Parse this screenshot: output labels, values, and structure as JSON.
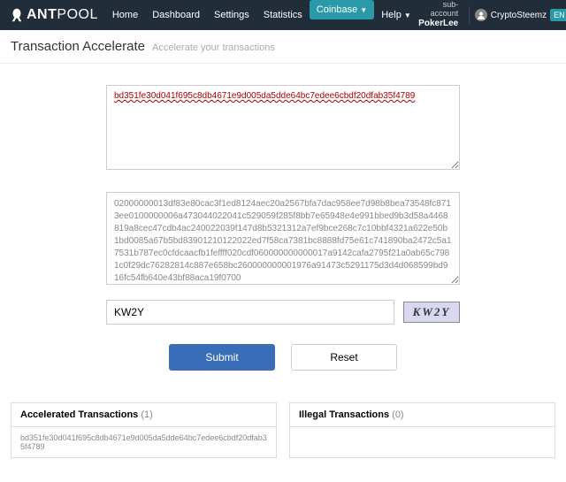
{
  "logo": {
    "brand_a": "ANT",
    "brand_b": "POOL"
  },
  "nav": {
    "home": "Home",
    "dashboard": "Dashboard",
    "settings": "Settings",
    "statistics": "Statistics",
    "coinbase": "Coinbase",
    "help": "Help"
  },
  "account": {
    "sub_label": "current sub-account",
    "sub_value": "PokerLee",
    "username": "CryptoSteemz",
    "lang": "EN"
  },
  "page": {
    "title": "Transaction Accelerate",
    "subtitle": "Accelerate your transactions"
  },
  "form": {
    "txid": "bd351fe30d041f695c8db4671e9d005da5dde64bc7edee6cbdf20dfab35f4789",
    "rawtx": "02000000013df83e80cac3f1ed8124aec20a2567bfa7dac958ee7d98b8bea73548fc8713ee0100000006a473044022041c529059f285f8bb7e65948e4e991bbed9b3d58a4468819a8cec47cdb4ac240022039f147d8b5321312a7ef9bce268c7c10bbf4321a622e50b1bd0085a67b5bd83901210122022ed7f58ca7381bc8888fd75e61c741890ba2472c5a17531b787ec0cfdcaacfb1feffff020cdf060000000000017a9142cafa2795f21a0ab65c7981c0f29dc76282814c887e658bc260000000001976a91473c5291175d3d4d068599bd916fc54fb640e43bf88aca19f0700",
    "captcha_value": "KW2Y",
    "captcha_image": "KW2Y",
    "submit": "Submit",
    "reset": "Reset"
  },
  "panels": {
    "accel_title": "Accelerated Transactions",
    "accel_count": "(1)",
    "accel_item": "bd351fe30d041f695c8db4671e9d005da5dde64bc7edee6cbdf20dfab35f4789",
    "illegal_title": "Illegal Transactions",
    "illegal_count": "(0)"
  }
}
